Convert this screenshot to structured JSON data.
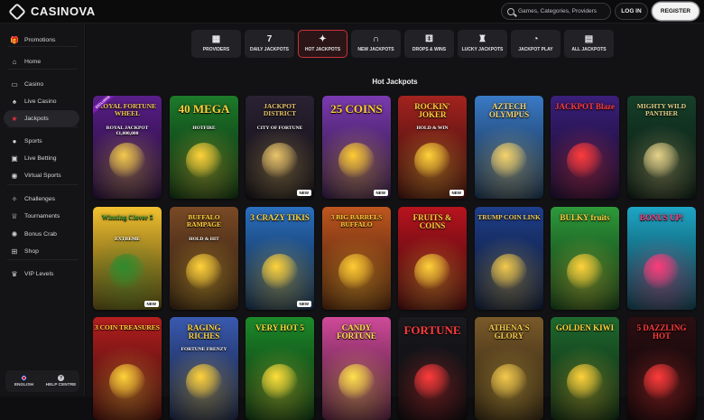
{
  "header": {
    "logo_text": "CASINOVA",
    "search_placeholder": "Games, Categories, Providers",
    "login_label": "LOG IN",
    "register_label": "REGISTER"
  },
  "sidebar": {
    "items": [
      {
        "label": "Promotions",
        "icon": "gift-icon"
      },
      {
        "label": "Home",
        "icon": "home-icon"
      },
      {
        "label": "Casino",
        "icon": "slot-icon"
      },
      {
        "label": "Live Casino",
        "icon": "live-casino-icon"
      },
      {
        "label": "Jackpots",
        "icon": "jackpot-icon"
      },
      {
        "label": "Sports",
        "icon": "soccer-ball-icon"
      },
      {
        "label": "Live Betting",
        "icon": "live-betting-icon"
      },
      {
        "label": "Virtual Sports",
        "icon": "virtual-sports-icon"
      },
      {
        "label": "Challenges",
        "icon": "challenges-icon"
      },
      {
        "label": "Tournaments",
        "icon": "trophy-icon"
      },
      {
        "label": "Bonus Crab",
        "icon": "crab-icon"
      },
      {
        "label": "Shop",
        "icon": "shop-icon"
      },
      {
        "label": "VIP Levels",
        "icon": "crown-icon"
      }
    ],
    "active": "Jackpots",
    "footer": {
      "language_label": "ENGLISH",
      "help_label": "HELP CENTRE"
    }
  },
  "tabs": [
    {
      "label": "PROVIDERS",
      "icon": "providers-icon"
    },
    {
      "label": "DAILY JACKPOTS",
      "icon": "calendar-icon"
    },
    {
      "label": "HOT JACKPOTS",
      "icon": "flame-icon"
    },
    {
      "label": "NEW JACKPOTS",
      "icon": "horseshoe-icon"
    },
    {
      "label": "DROPS & WINS",
      "icon": "dice-icon"
    },
    {
      "label": "LUCKY JACKPOTS",
      "icon": "money-bag-icon"
    },
    {
      "label": "JACKPOT PLAY",
      "icon": "stopwatch-icon"
    },
    {
      "label": "ALL JACKPOTS",
      "icon": "cash-icon"
    }
  ],
  "active_tab": "HOT JACKPOTS",
  "section_title": "Hot Jackpots",
  "new_badge_label": "NEW",
  "exclusive_badge_label": "EXCLUSIVE",
  "games": [
    {
      "title": "ROYAL FORTUNE WHEEL",
      "subtitle": "ROYAL JACKPOT €1,000,000",
      "bg": "#5a1f8a",
      "accent": "#f2c94c",
      "new": false,
      "exclusive": true
    },
    {
      "title": "40 MEGA",
      "subtitle": "HOTFIRE",
      "bg": "#1d7a2a",
      "accent": "#ffd23a",
      "new": false
    },
    {
      "title": "JACKPOT DISTRICT",
      "subtitle": "CITY OF FORTUNE",
      "bg": "#2a2233",
      "accent": "#e9c46a",
      "new": true
    },
    {
      "title": "25 COINS",
      "subtitle": "",
      "bg": "#7a3ab0",
      "accent": "#ffcc33",
      "new": true
    },
    {
      "title": "ROCKIN' JOKER",
      "subtitle": "HOLD & WIN",
      "bg": "#a3231f",
      "accent": "#ffd23a",
      "new": true
    },
    {
      "title": "AZTECH OLYMPUS",
      "subtitle": "",
      "bg": "#3a7ac6",
      "accent": "#f6d36b",
      "new": false
    },
    {
      "title": "JACKPOT Blaze",
      "subtitle": "",
      "bg": "#3b1f7a",
      "accent": "#ff3b3b",
      "new": false
    },
    {
      "title": "MIGHTY WILD PANTHER",
      "subtitle": "",
      "bg": "#16402a",
      "accent": "#e6d28a",
      "new": false
    },
    {
      "title": "Winning Clover 5",
      "subtitle": "EXTREME",
      "bg": "#f2c230",
      "accent": "#2e8b2e",
      "new": true
    },
    {
      "title": "BUFFALO RAMPAGE",
      "subtitle": "HOLD & HIT",
      "bg": "#7a4a26",
      "accent": "#ffd23a",
      "new": false
    },
    {
      "title": "3 CRAZY TIKIS",
      "subtitle": "",
      "bg": "#2a6fc0",
      "accent": "#ffd23a",
      "new": true
    },
    {
      "title": "3 BIG BARRELS BUFFALO",
      "subtitle": "",
      "bg": "#c0561f",
      "accent": "#ffcc33",
      "new": false
    },
    {
      "title": "FRUITS & COINS",
      "subtitle": "",
      "bg": "#b8141e",
      "accent": "#ffd23a",
      "new": false
    },
    {
      "title": "TRUMP COIN LINK",
      "subtitle": "",
      "bg": "#1f3f8a",
      "accent": "#f2c94c",
      "new": false
    },
    {
      "title": "BULKY fruits",
      "subtitle": "",
      "bg": "#2e9a3a",
      "accent": "#ffd23a",
      "new": false
    },
    {
      "title": "BONUS UP!",
      "subtitle": "",
      "bg": "#1ea6c6",
      "accent": "#ff3b7a",
      "new": false
    },
    {
      "title": "3 COIN TREASURES",
      "subtitle": "",
      "bg": "#b31f1f",
      "accent": "#ffd23a",
      "new": false
    },
    {
      "title": "RAGING RICHES",
      "subtitle": "FORTUNE FRENZY",
      "bg": "#3a5ab0",
      "accent": "#ffd23a",
      "new": false
    },
    {
      "title": "VERY HOT 5",
      "subtitle": "",
      "bg": "#1d8a2a",
      "accent": "#ffdf3a",
      "new": false
    },
    {
      "title": "CANDY FORTUNE",
      "subtitle": "",
      "bg": "#d04a9a",
      "accent": "#ffe14a",
      "new": false
    },
    {
      "title": "FORTUNE",
      "subtitle": "",
      "bg": "#1a1a1f",
      "accent": "#ff3b3b",
      "new": false
    },
    {
      "title": "ATHENA'S GLORY",
      "subtitle": "",
      "bg": "#7a5a2a",
      "accent": "#f2c94c",
      "new": false
    },
    {
      "title": "GOLDEN KIWI",
      "subtitle": "",
      "bg": "#1f6a2e",
      "accent": "#ffd23a",
      "new": false
    },
    {
      "title": "5 DAZZLING HOT",
      "subtitle": "",
      "bg": "#2a0f12",
      "accent": "#ff3b3b",
      "new": false
    }
  ]
}
